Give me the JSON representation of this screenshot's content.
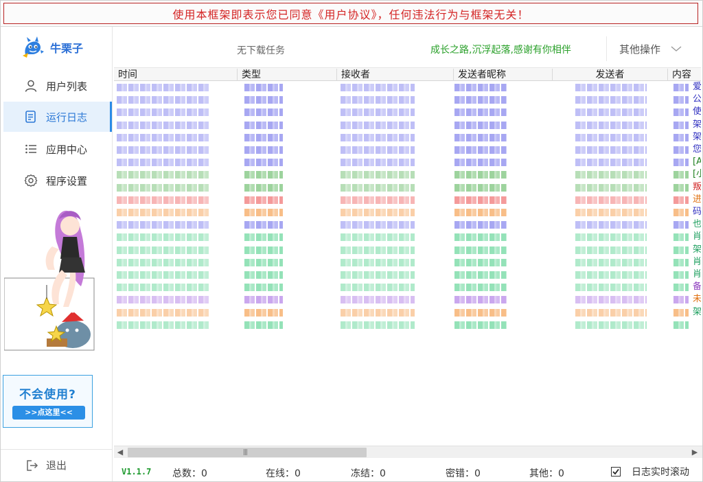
{
  "notice": "使用本框架即表示您已同意《用户协议》，任何违法行为与框架无关！",
  "logo": {
    "text": "牛栗子",
    "icon": "dragon-logo-icon"
  },
  "sidebar": {
    "items": [
      {
        "label": "用户列表",
        "icon": "user-icon",
        "active": false
      },
      {
        "label": "运行日志",
        "icon": "document-icon",
        "active": true
      },
      {
        "label": "应用中心",
        "icon": "list-icon",
        "active": false
      },
      {
        "label": "程序设置",
        "icon": "gear-icon",
        "active": false
      }
    ],
    "help": {
      "title": "不会使用?",
      "button": ">>点这里<<"
    },
    "logout": "退出"
  },
  "header": {
    "task_status": "无下载任务",
    "slogan": "成长之路,沉浮起落,感谢有你相伴",
    "other_ops": "其他操作"
  },
  "table": {
    "columns": [
      "时间",
      "类型",
      "接收者",
      "发送者昵称",
      "发送者",
      "内容"
    ],
    "row_colors": [
      "#8a8aee",
      "#8a8aee",
      "#8a8aee",
      "#8a8aee",
      "#8a8aee",
      "#8a8aee",
      "#8a8aee",
      "#7cc47c",
      "#7cc47c",
      "#f07878",
      "#f5a860",
      "#8a8aee",
      "#70d8a0",
      "#70d8a0",
      "#70d8a0",
      "#70d8a0",
      "#70d8a0",
      "#b88ae8",
      "#f5a860",
      "#70d8a0"
    ],
    "content_chars": [
      "爱",
      "公",
      "使",
      "架",
      "架",
      "您",
      "[A",
      "[小",
      "叛",
      "进",
      "码",
      "也",
      "肖",
      "架",
      "肖",
      "肖",
      "备",
      "未",
      "架"
    ],
    "content_colors": [
      "#3030c0",
      "#3030c0",
      "#3030c0",
      "#3030c0",
      "#3030c0",
      "#3030c0",
      "#208020",
      "#208020",
      "#d02020",
      "#e07010",
      "#3030c0",
      "#20a060",
      "#20a060",
      "#20a060",
      "#20a060",
      "#20a060",
      "#9040c0",
      "#e07010",
      "#20a060"
    ]
  },
  "status": {
    "version": "V1.1.7",
    "total": "总数：0",
    "online": "在线：0",
    "frozen": "冻结：0",
    "pwd_error": "密错：0",
    "other": "其他：0",
    "autoscroll_label": "日志实时滚动",
    "autoscroll_checked": true
  }
}
